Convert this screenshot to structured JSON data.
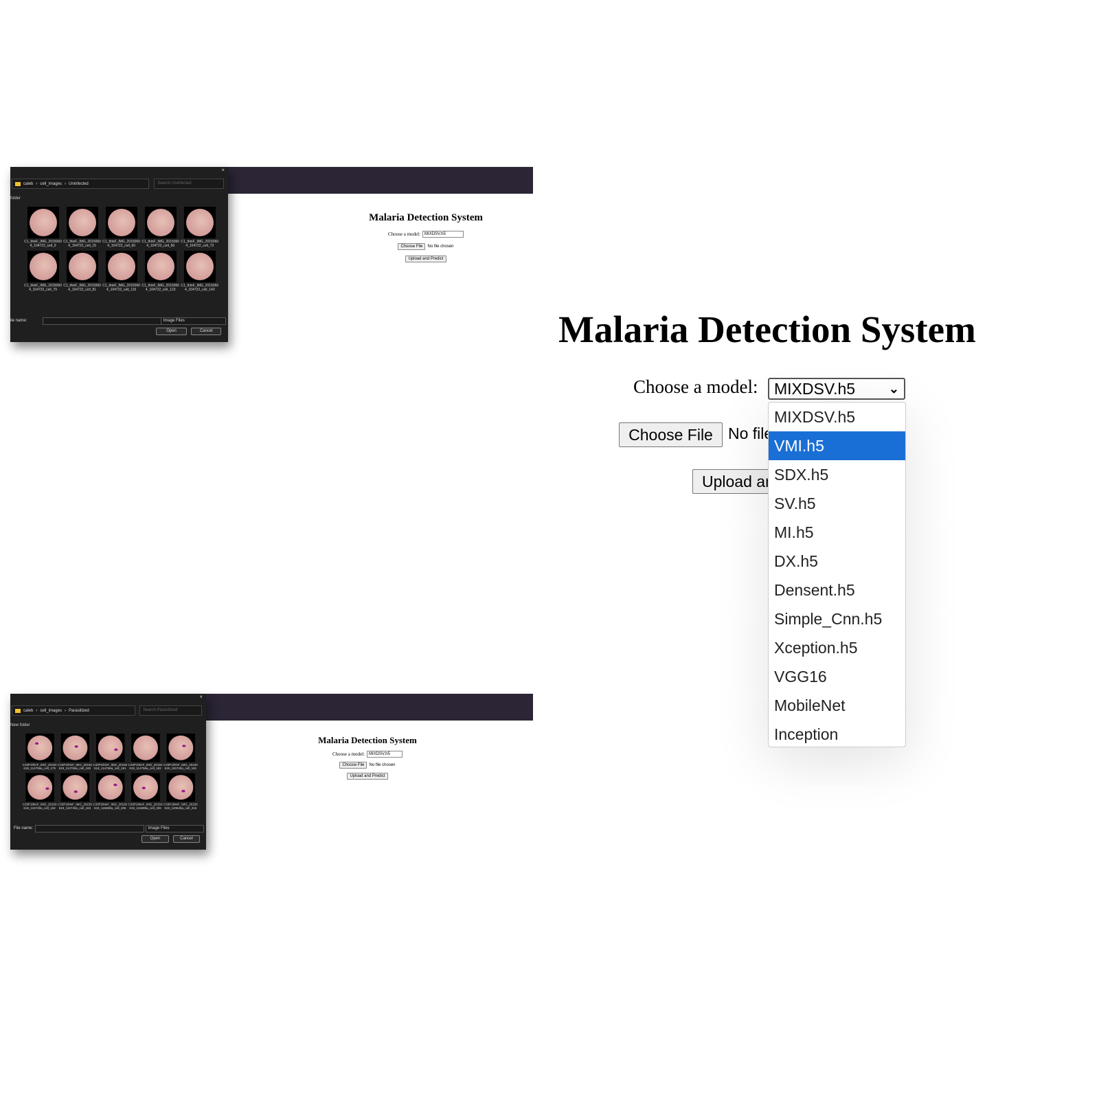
{
  "app": {
    "title": "Malaria Detection System",
    "model_label": "Choose a model:",
    "selected_model": "MIXDSV.h5",
    "choose_file": "Choose File",
    "no_file": "No file chosen",
    "upload": "Upload and Predict"
  },
  "dialogs": [
    {
      "breadcrumb": [
        "caleb",
        "cell_images",
        "Uninfected"
      ],
      "search_placeholder": "Search Uninfected",
      "new_folder": "folder",
      "files": [
        "C1_thinF_IMG_20150604_104722_cell_9",
        "C1_thinF_IMG_20150604_104722_cell_15",
        "C1_thinF_IMG_20150604_104722_cell_60",
        "C1_thinF_IMG_20150604_104722_cell_66",
        "C1_thinF_IMG_20150604_104722_cell_73",
        "C1_thinF_IMG_20150604_104722_cell_79",
        "C1_thinF_IMG_20150604_104722_cell_81",
        "C1_thinF_IMG_20150604_104722_cell_115",
        "C1_thinF_IMG_20150604_104722_cell_123",
        "C1_thinF_IMG_20150604_104722_cell_143"
      ],
      "file_name_label": "ile name:",
      "file_type": "Image Files",
      "open": "Open",
      "cancel": "Cancel",
      "close": "×"
    },
    {
      "breadcrumb": [
        "caleb",
        "cell_images",
        "Parasitized"
      ],
      "search_placeholder": "Search Parasitized",
      "new_folder": "New folder",
      "files": [
        "C33P1thinF_IMG_20150619_114756a_cell_179",
        "C33P1thinF_IMG_20150619_114756a_cell_180",
        "C33P1thinF_IMG_20150619_114756a_cell_181",
        "C33P1thinF_IMG_20150619_114756a_cell_182",
        "C33P1thinF_IMG_20150619_115740a_cell_161",
        "C33P1thinF_IMG_20150619_115740a_cell_162",
        "C33P1thinF_IMG_20150619_115740a_cell_163",
        "C33P1thinF_IMG_20150619_115808a_cell_205",
        "C33P1thinF_IMG_20150619_115808a_cell_206",
        "C33P1thinF_IMG_20150619_120645a_cell_215"
      ],
      "file_name_label": "File name:",
      "file_type": "Image Files",
      "open": "Open",
      "cancel": "Cancel",
      "close": "×"
    }
  ],
  "model_options": [
    "MIXDSV.h5",
    "VMI.h5",
    "SDX.h5",
    "SV.h5",
    "MI.h5",
    "DX.h5",
    "Densent.h5",
    "Simple_Cnn.h5",
    "Xception.h5",
    "VGG16",
    "MobileNet",
    "Inception"
  ],
  "highlighted_option": 1,
  "colors": {
    "highlight": "#1a6fd6",
    "band": "#2b2535",
    "dialog": "#1f1f1f"
  }
}
